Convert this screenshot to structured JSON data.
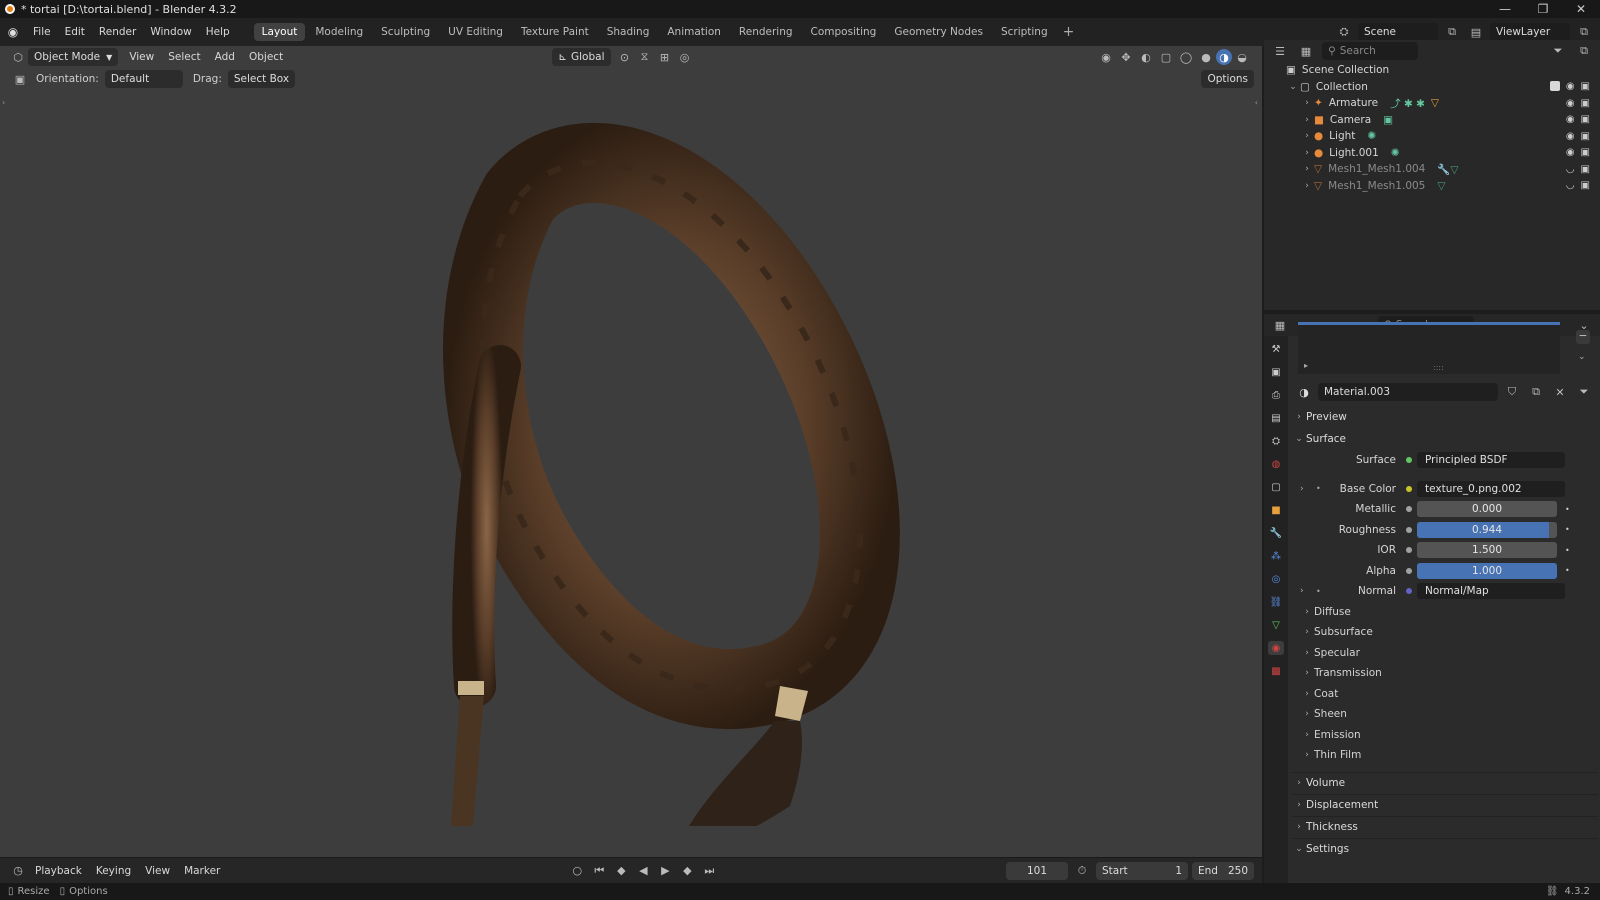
{
  "window": {
    "title": "* tortai [D:\\tortai.blend] - Blender 4.3.2",
    "min": "—",
    "max": "❐",
    "close": "✕"
  },
  "menu": [
    "File",
    "Edit",
    "Render",
    "Window",
    "Help"
  ],
  "workspaces": [
    "Layout",
    "Modeling",
    "Sculpting",
    "UV Editing",
    "Texture Paint",
    "Shading",
    "Animation",
    "Rendering",
    "Compositing",
    "Geometry Nodes",
    "Scripting"
  ],
  "active_workspace": "Layout",
  "scene": {
    "name": "Scene",
    "view_layer": "ViewLayer"
  },
  "viewport": {
    "mode": "Object Mode",
    "menus": [
      "View",
      "Select",
      "Add",
      "Object"
    ],
    "transform": "Global",
    "orientation_label": "Orientation:",
    "orientation_value": "Default",
    "drag_label": "Drag:",
    "drag_value": "Select Box",
    "options": "Options"
  },
  "timeline": {
    "menus": [
      "Playback",
      "Keying",
      "View",
      "Marker"
    ],
    "current_frame": "101",
    "start_label": "Start",
    "start": "1",
    "end_label": "End",
    "end": "250"
  },
  "status": {
    "left1": "Resize",
    "left2": "Options",
    "version": "4.3.2"
  },
  "outliner": {
    "search_placeholder": "Search",
    "scene_collection": "Scene Collection",
    "collection": "Collection",
    "items": [
      {
        "name": "Armature",
        "icon": "armature-icon",
        "color": "#e88a3c",
        "dim": false
      },
      {
        "name": "Camera",
        "icon": "camera-icon",
        "color": "#e88a3c",
        "dim": false
      },
      {
        "name": "Light",
        "icon": "light-icon",
        "color": "#e88a3c",
        "dim": false
      },
      {
        "name": "Light.001",
        "icon": "light-icon",
        "color": "#e88a3c",
        "dim": false
      },
      {
        "name": "Mesh1_Mesh1.004",
        "icon": "mesh-icon",
        "color": "#e88a3c",
        "dim": true
      },
      {
        "name": "Mesh1_Mesh1.005",
        "icon": "mesh-icon",
        "color": "#e88a3c",
        "dim": true
      }
    ]
  },
  "properties": {
    "search_placeholder": "Search",
    "material_name": "Material.003",
    "preview": "Preview",
    "surface_section": "Surface",
    "surface_label": "Surface",
    "surface_value": "Principled BSDF",
    "base_color_label": "Base Color",
    "base_color_value": "texture_0.png.002",
    "metallic_label": "Metallic",
    "metallic": "0.000",
    "metallic_fraction": 0.0,
    "roughness_label": "Roughness",
    "roughness": "0.944",
    "roughness_fraction": 0.944,
    "ior_label": "IOR",
    "ior": "1.500",
    "ior_fraction": 0.0,
    "alpha_label": "Alpha",
    "alpha": "1.000",
    "alpha_fraction": 1.0,
    "normal_label": "Normal",
    "normal_value": "Normal/Map",
    "subpanels": [
      "Diffuse",
      "Subsurface",
      "Specular",
      "Transmission",
      "Coat",
      "Sheen",
      "Emission",
      "Thin Film"
    ],
    "sections": [
      "Volume",
      "Displacement",
      "Thickness",
      "Settings"
    ]
  },
  "colors": {
    "accent": "#4772b3",
    "orange": "#e87d0d",
    "socket_yellow": "#c7c729",
    "socket_grey": "#a1a1a1",
    "socket_blue": "#6363c7",
    "socket_green": "#63c763"
  }
}
